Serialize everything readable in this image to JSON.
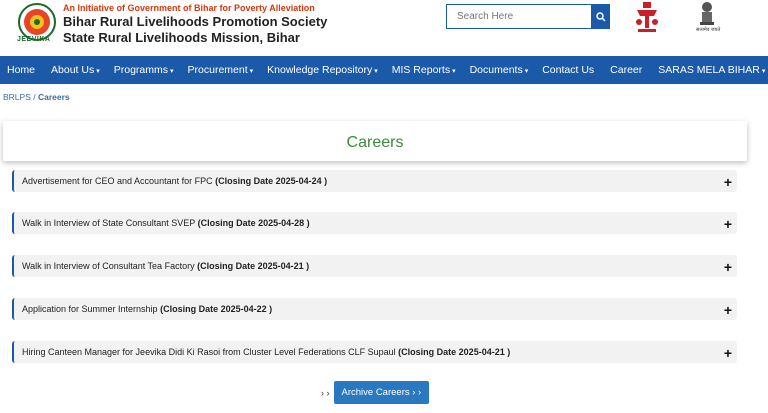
{
  "header": {
    "tagline": "An Initiative of Government of Bihar for Poverty Alleviation",
    "org_line1": "Bihar Rural Livelihoods Promotion Society",
    "org_line2": "State Rural Livelihoods Mission, Bihar",
    "logo_text": "JEEVIKA",
    "emblem_text": "सत्यमेव जयते"
  },
  "search": {
    "placeholder": "Search Here"
  },
  "nav": [
    {
      "label": "Home",
      "caret": ""
    },
    {
      "label": "About Us",
      "caret": "▾"
    },
    {
      "label": "Programms",
      "caret": "▾"
    },
    {
      "label": "Procurement",
      "caret": "▾"
    },
    {
      "label": "Knowledge Repository",
      "caret": "▾"
    },
    {
      "label": "MIS Reports",
      "caret": "▾"
    },
    {
      "label": "Documents",
      "caret": "▾"
    },
    {
      "label": "Contact Us",
      "caret": ""
    },
    {
      "label": "Career",
      "caret": ""
    },
    {
      "label": "SARAS MELA BIHAR",
      "caret": "▾"
    }
  ],
  "breadcrumb": {
    "root": "BRLPS",
    "sep": " / ",
    "current": "Careers"
  },
  "page_title": "Careers",
  "careers": [
    {
      "title": "Advertisement for CEO and Accountant for FPC ",
      "closing": "(Closing Date 2025-04-24 )"
    },
    {
      "title": "Walk in Interview of State Consultant SVEP ",
      "closing": "(Closing Date 2025-04-28 )"
    },
    {
      "title": "Walk in Interview of Consultant Tea Factory ",
      "closing": "(Closing Date 2025-04-21 )"
    },
    {
      "title": "Application for Summer Internship ",
      "closing": "(Closing Date 2025-04-22 )"
    },
    {
      "title": "Hiring Canteen Manager for Jeevika Didi Ki Rasoi from Cluster Level Federations CLF Supaul ",
      "closing": "(Closing Date 2025-04-21 )"
    }
  ],
  "expand_symbol": "+",
  "archive": {
    "arrows": "› ›",
    "label": "Archive Careers › ›"
  },
  "colors": {
    "nav": "#1a5aa8",
    "title": "#3a8a3a",
    "accent": "#d33a10"
  }
}
